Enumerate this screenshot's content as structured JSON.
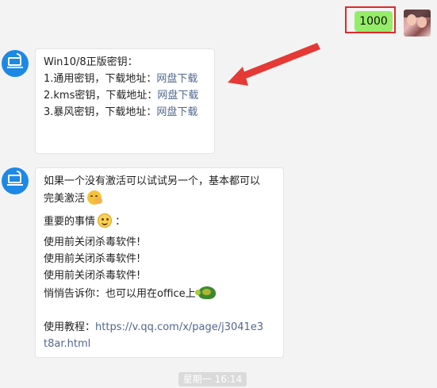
{
  "self_message": {
    "text": "1000"
  },
  "message1": {
    "title": "Win10/8正版密钥：",
    "items": [
      {
        "label": "1.通用密钥，下载地址：",
        "link": "网盘下载"
      },
      {
        "label": "2.kms密钥，下载地址：",
        "link": "网盘下载"
      },
      {
        "label": "3.暴风密钥，下载地址：",
        "link": "网盘下载"
      }
    ]
  },
  "message2": {
    "line1": "如果一个没有激活可以试试另一个，基本都可以",
    "line2": "完美激活",
    "line3a": "重要的事情",
    "line3b": "：",
    "warnings": [
      "使用前关闭杀毒软件!",
      "使用前关闭杀毒软件!",
      "使用前关闭杀毒软件!"
    ],
    "line7": "悄悄告诉你：也可以用在office上",
    "tutorial_label": "使用教程：",
    "tutorial_url_1": "https://v.qq.com/x/page/j3041e3",
    "tutorial_url_2": "t8ar.html"
  },
  "timestamp": "星期一 16:14",
  "icons": {
    "bot_avatar": "computer-icon",
    "emoji_1": "blush-emoji-icon",
    "emoji_2": "smile-emoji-icon",
    "emoji_3": "turtle-emoji-icon"
  },
  "colors": {
    "self_bubble": "#95ec69",
    "highlight": "#e2282d",
    "link": "#50688e",
    "bot_avatar": "#1e88e5"
  }
}
